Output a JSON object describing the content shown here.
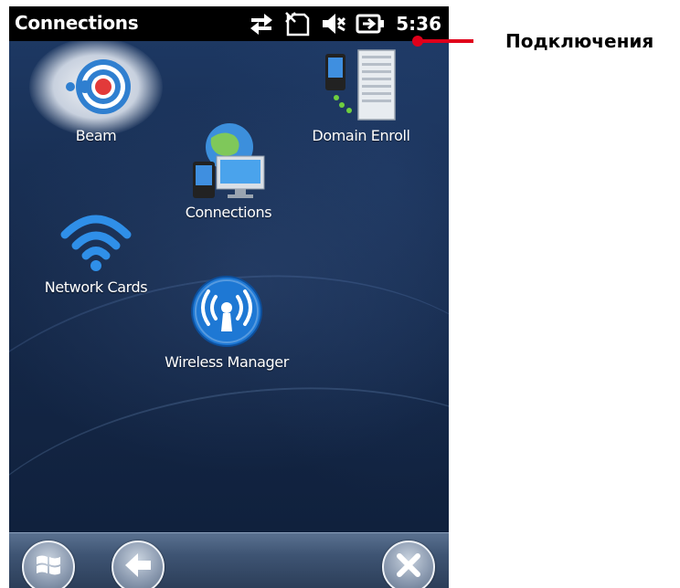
{
  "status_bar": {
    "title": "Connections",
    "time": "5:36",
    "icons": [
      "data-sync-icon",
      "no-sim-icon",
      "speaker-muted-icon",
      "battery-charging-icon"
    ]
  },
  "apps": [
    {
      "label": "Beam",
      "icon": "beam-icon"
    },
    {
      "label": "Domain Enroll",
      "icon": "domain-enroll-icon"
    },
    {
      "label": "Connections",
      "icon": "connections-icon"
    },
    {
      "label": "Network Cards",
      "icon": "wifi-icon"
    },
    {
      "label": "Wireless Manager",
      "icon": "wireless-manager-icon"
    }
  ],
  "bottom_bar": {
    "buttons": [
      "windows-start-icon",
      "back-arrow-icon",
      "close-icon"
    ]
  },
  "annotation": {
    "text": "Подключения",
    "color": "#e0001a"
  }
}
